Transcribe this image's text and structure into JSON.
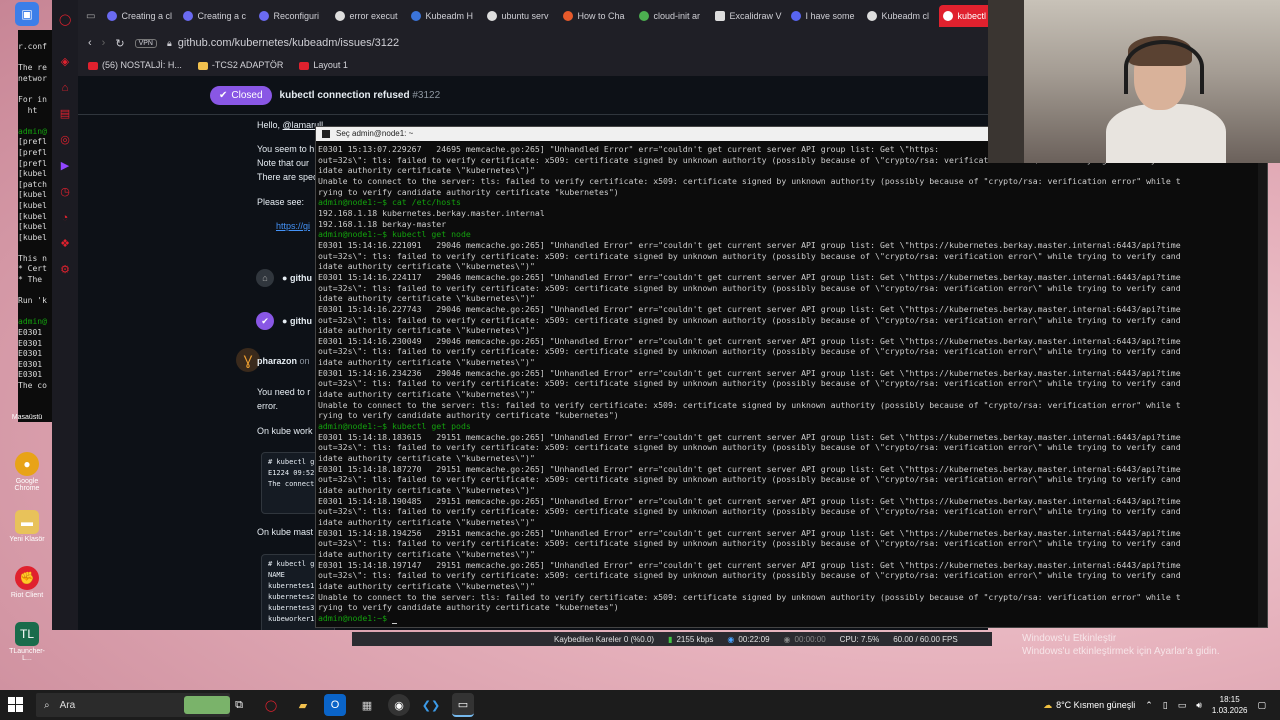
{
  "desktop": {
    "icons": [
      {
        "label": "Masaüstü",
        "icon": "folder-icon",
        "color": "#3c7ee8"
      },
      {
        "label": "Google Chrome",
        "icon": "chrome-icon",
        "color": "#e8a317"
      },
      {
        "label": "Yeni Klasör",
        "icon": "folder-icon",
        "color": "#e8c25a"
      },
      {
        "label": "Riot Client",
        "icon": "riot-icon",
        "color": "#e0212e"
      },
      {
        "label": "TLauncher-L...",
        "icon": "tlauncher-icon",
        "color": "#1a6b4b"
      }
    ],
    "bg_terminal_lines": [
      "r.conf",
      "",
      "The re",
      "networ",
      "",
      "For in",
      "  ht",
      "",
      "admin@",
      "[prefl",
      "[prefl",
      "[prefl",
      "[kubel",
      "[patch",
      "[kubel",
      "[kubel",
      "[kubel",
      "[kubel",
      "[kubel",
      "",
      "This n",
      "* Cert",
      "* The",
      "",
      "Run 'k",
      "",
      "admin@",
      "E0301",
      "E0301",
      "E0301",
      "E0301",
      "E0301",
      "The co"
    ]
  },
  "browser": {
    "tabs": [
      "Creating a cl",
      "Creating a c",
      "Reconfiguri",
      "error execut",
      "Kubeadm H",
      "ubuntu serv",
      "How to Cha",
      "cloud-init ar",
      "Excalidraw V",
      "I have some",
      "Kubeadm cl",
      "kubectl"
    ],
    "active_tab": "kubectl",
    "vpn_label": "VPN",
    "url": "github.com/kubernetes/kubeadm/issues/3122",
    "bookmarks": [
      "(56) NOSTALJİ: H...",
      "-TCS2 ADAPTÖR",
      "Layout 1"
    ],
    "issue": {
      "status": "Closed",
      "title": "kubectl connection refused",
      "number": "#3122",
      "greeting": "Hello,",
      "mention": "@lamarull",
      "p1": "You seem to h",
      "p2": "Note that our",
      "p3": "There are spec",
      "please_see": "Please see:",
      "link": "https://gi",
      "event1": "githu",
      "event2": "githu",
      "commenter": "pharazon",
      "commenter_suffix": "on",
      "c1": "You need to r",
      "c2": "error.",
      "c3": "On kube work",
      "code1": "# kubectl g\nE1224 09:52\nThe connect",
      "c4": "On kube mast",
      "code2": "# kubectl g\nNAME\nkubernetes1\nkubernetes2\nkubernetes3\nkubeworker1"
    }
  },
  "terminal": {
    "title": "Seç admin@node1: ~",
    "lines": [
      {
        "t": "E0301 15:13:07.229267   24695 memcache.go:265] \"Unhandled Error\" err=\"couldn't get current server API group list: Get \\\"https:",
        "p": false
      },
      {
        "t": "out=32s\\\": tls: failed to verify certificate: x509: certificate signed by unknown authority (possibly because of \\\"crypto/rsa: verification error\\\" while trying to verify cand",
        "p": false
      },
      {
        "t": "idate authority certificate \\\"kubernetes\\\")\"",
        "p": false
      },
      {
        "t": "Unable to connect to the server: tls: failed to verify certificate: x509: certificate signed by unknown authority (possibly because of \"crypto/rsa: verification error\" while t",
        "p": false
      },
      {
        "t": "rying to verify candidate authority certificate \"kubernetes\")",
        "p": false
      },
      {
        "t": "admin@node1:~$ cat /etc/hosts",
        "p": true
      },
      {
        "t": "192.168.1.18 kubernetes.berkay.master.internal",
        "p": false
      },
      {
        "t": "192.168.1.18 berkay-master",
        "p": false
      },
      {
        "t": "admin@node1:~$ kubectl get node",
        "p": true
      },
      {
        "t": "E0301 15:14:16.221091   29046 memcache.go:265] \"Unhandled Error\" err=\"couldn't get current server API group list: Get \\\"https://kubernetes.berkay.master.internal:6443/api?time",
        "p": false
      },
      {
        "t": "out=32s\\\": tls: failed to verify certificate: x509: certificate signed by unknown authority (possibly because of \\\"crypto/rsa: verification error\\\" while trying to verify cand",
        "p": false
      },
      {
        "t": "idate authority certificate \\\"kubernetes\\\")\"",
        "p": false
      },
      {
        "t": "E0301 15:14:16.224117   29046 memcache.go:265] \"Unhandled Error\" err=\"couldn't get current server API group list: Get \\\"https://kubernetes.berkay.master.internal:6443/api?time",
        "p": false
      },
      {
        "t": "out=32s\\\": tls: failed to verify certificate: x509: certificate signed by unknown authority (possibly because of \\\"crypto/rsa: verification error\\\" while trying to verify cand",
        "p": false
      },
      {
        "t": "idate authority certificate \\\"kubernetes\\\")\"",
        "p": false
      },
      {
        "t": "E0301 15:14:16.227743   29046 memcache.go:265] \"Unhandled Error\" err=\"couldn't get current server API group list: Get \\\"https://kubernetes.berkay.master.internal:6443/api?time",
        "p": false
      },
      {
        "t": "out=32s\\\": tls: failed to verify certificate: x509: certificate signed by unknown authority (possibly because of \\\"crypto/rsa: verification error\\\" while trying to verify cand",
        "p": false
      },
      {
        "t": "idate authority certificate \\\"kubernetes\\\")\"",
        "p": false
      },
      {
        "t": "E0301 15:14:16.230049   29046 memcache.go:265] \"Unhandled Error\" err=\"couldn't get current server API group list: Get \\\"https://kubernetes.berkay.master.internal:6443/api?time",
        "p": false
      },
      {
        "t": "out=32s\\\": tls: failed to verify certificate: x509: certificate signed by unknown authority (possibly because of \\\"crypto/rsa: verification error\\\" while trying to verify cand",
        "p": false
      },
      {
        "t": "idate authority certificate \\\"kubernetes\\\")\"",
        "p": false
      },
      {
        "t": "E0301 15:14:16.234236   29046 memcache.go:265] \"Unhandled Error\" err=\"couldn't get current server API group list: Get \\\"https://kubernetes.berkay.master.internal:6443/api?time",
        "p": false
      },
      {
        "t": "out=32s\\\": tls: failed to verify certificate: x509: certificate signed by unknown authority (possibly because of \\\"crypto/rsa: verification error\\\" while trying to verify cand",
        "p": false
      },
      {
        "t": "idate authority certificate \\\"kubernetes\\\")\"",
        "p": false
      },
      {
        "t": "Unable to connect to the server: tls: failed to verify certificate: x509: certificate signed by unknown authority (possibly because of \"crypto/rsa: verification error\" while t",
        "p": false
      },
      {
        "t": "rying to verify candidate authority certificate \"kubernetes\")",
        "p": false
      },
      {
        "t": "admin@node1:~$ kubectl get pods",
        "p": true
      },
      {
        "t": "E0301 15:14:18.183615   29151 memcache.go:265] \"Unhandled Error\" err=\"couldn't get current server API group list: Get \\\"https://kubernetes.berkay.master.internal:6443/api?time",
        "p": false
      },
      {
        "t": "out=32s\\\": tls: failed to verify certificate: x509: certificate signed by unknown authority (possibly because of \\\"crypto/rsa: verification error\\\" while trying to verify cand",
        "p": false
      },
      {
        "t": "idate authority certificate \\\"kubernetes\\\")\"",
        "p": false
      },
      {
        "t": "E0301 15:14:18.187270   29151 memcache.go:265] \"Unhandled Error\" err=\"couldn't get current server API group list: Get \\\"https://kubernetes.berkay.master.internal:6443/api?time",
        "p": false
      },
      {
        "t": "out=32s\\\": tls: failed to verify certificate: x509: certificate signed by unknown authority (possibly because of \\\"crypto/rsa: verification error\\\" while trying to verify cand",
        "p": false
      },
      {
        "t": "idate authority certificate \\\"kubernetes\\\")\"",
        "p": false
      },
      {
        "t": "E0301 15:14:18.190485   29151 memcache.go:265] \"Unhandled Error\" err=\"couldn't get current server API group list: Get \\\"https://kubernetes.berkay.master.internal:6443/api?time",
        "p": false
      },
      {
        "t": "out=32s\\\": tls: failed to verify certificate: x509: certificate signed by unknown authority (possibly because of \\\"crypto/rsa: verification error\\\" while trying to verify cand",
        "p": false
      },
      {
        "t": "idate authority certificate \\\"kubernetes\\\")\"",
        "p": false
      },
      {
        "t": "E0301 15:14:18.194256   29151 memcache.go:265] \"Unhandled Error\" err=\"couldn't get current server API group list: Get \\\"https://kubernetes.berkay.master.internal:6443/api?time",
        "p": false
      },
      {
        "t": "out=32s\\\": tls: failed to verify certificate: x509: certificate signed by unknown authority (possibly because of \\\"crypto/rsa: verification error\\\" while trying to verify cand",
        "p": false
      },
      {
        "t": "idate authority certificate \\\"kubernetes\\\")\"",
        "p": false
      },
      {
        "t": "E0301 15:14:18.197147   29151 memcache.go:265] \"Unhandled Error\" err=\"couldn't get current server API group list: Get \\\"https://kubernetes.berkay.master.internal:6443/api?time",
        "p": false
      },
      {
        "t": "out=32s\\\": tls: failed to verify certificate: x509: certificate signed by unknown authority (possibly because of \\\"crypto/rsa: verification error\\\" while trying to verify cand",
        "p": false
      },
      {
        "t": "idate authority certificate \\\"kubernetes\\\")\"",
        "p": false
      },
      {
        "t": "Unable to connect to the server: tls: failed to verify certificate: x509: certificate signed by unknown authority (possibly because of \"crypto/rsa: verification error\" while t",
        "p": false
      },
      {
        "t": "rying to verify candidate authority certificate \"kubernetes\")",
        "p": false
      },
      {
        "t": "admin@node1:~$ ",
        "p": true
      }
    ]
  },
  "obs": {
    "dropped": "Kaybedilen Kareler 0 (%0.0)",
    "bitrate": "2155 kbps",
    "rec_time": "00:22:09",
    "stream_time": "00:00:00",
    "cpu": "CPU: 7.5%",
    "fps": "60.00 / 60.00 FPS"
  },
  "activate_windows": {
    "line1": "Windows'u Etkinleştir",
    "line2": "Windows'u etkinleştirmek için Ayarlar'a gidin."
  },
  "taskbar": {
    "search_placeholder": "Ara",
    "weather": "8°C  Kısmen güneşli",
    "time": "18:15",
    "date": "1.03.2026"
  },
  "colors": {
    "accent": "#e0212e",
    "closed": "#8957e5",
    "prompt": "#13a10e",
    "link": "#4493f8"
  }
}
